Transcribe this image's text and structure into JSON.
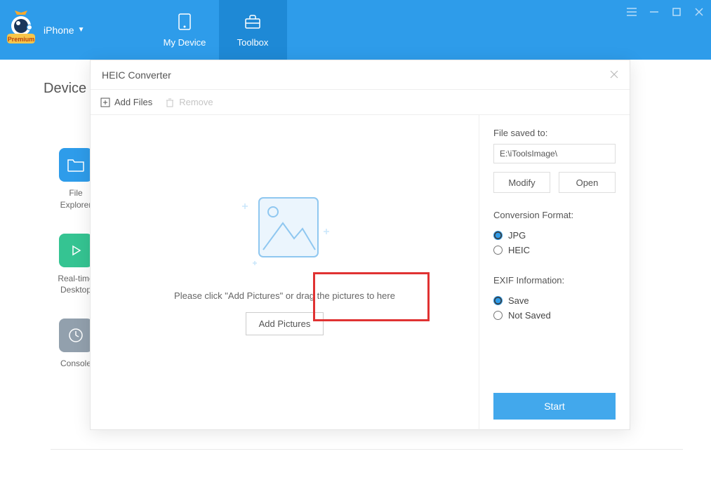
{
  "header": {
    "device_name": "iPhone",
    "badge": "Premium",
    "tabs": [
      {
        "label": "My Device"
      },
      {
        "label": "Toolbox"
      }
    ]
  },
  "body": {
    "section_label": "Device",
    "sidebar": [
      {
        "label": "File\nExplorer"
      },
      {
        "label": "Real-time\nDesktop"
      },
      {
        "label": "Console"
      }
    ]
  },
  "modal": {
    "title": "HEIC Converter",
    "toolbar": {
      "add_files": "Add Files",
      "remove": "Remove"
    },
    "dropzone": {
      "hint": "Please click \"Add Pictures\" or drag the pictures to here",
      "button": "Add Pictures"
    },
    "panel": {
      "saved_to_label": "File saved to:",
      "saved_to_path": "E:\\iToolsImage\\",
      "modify_btn": "Modify",
      "open_btn": "Open",
      "format_label": "Conversion Format:",
      "format_options": [
        "JPG",
        "HEIC"
      ],
      "format_selected": "JPG",
      "exif_label": "EXIF Information:",
      "exif_options": [
        "Save",
        "Not Saved"
      ],
      "exif_selected": "Save",
      "start_btn": "Start"
    }
  }
}
